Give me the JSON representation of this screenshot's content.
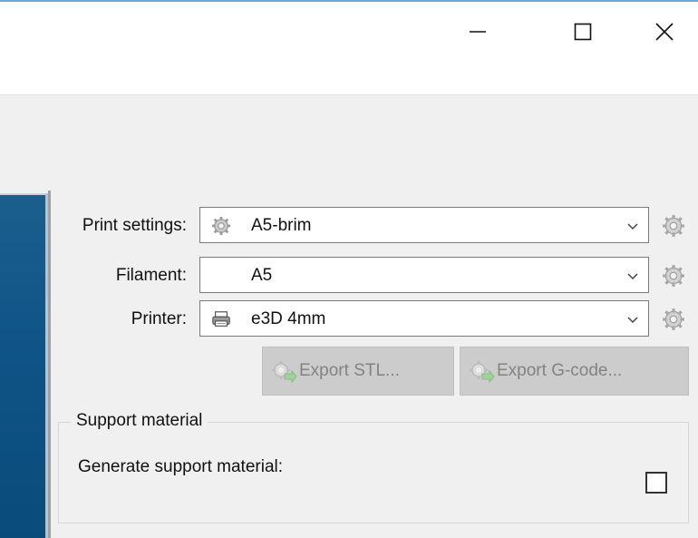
{
  "window": {
    "minimize_icon": "minimize-icon",
    "maximize_icon": "maximize-icon",
    "close_icon": "close-icon"
  },
  "settings": {
    "print_settings": {
      "label": "Print settings:",
      "value": "A5-brim",
      "icon": "gear-icon"
    },
    "filament": {
      "label": "Filament:",
      "value": "A5"
    },
    "printer": {
      "label": "Printer:",
      "value": "e3D 4mm",
      "icon": "printer-icon"
    }
  },
  "actions": {
    "export_stl": "Export STL...",
    "export_gcode": "Export G-code..."
  },
  "support": {
    "group_title": "Support material",
    "generate_label": "Generate support material:",
    "generate_checked": false
  },
  "colors": {
    "title_border": "#6fa8dc",
    "canvas": "#0f5486",
    "disabled_button": "#cccccc",
    "panel_bg": "#f0f0f0"
  }
}
